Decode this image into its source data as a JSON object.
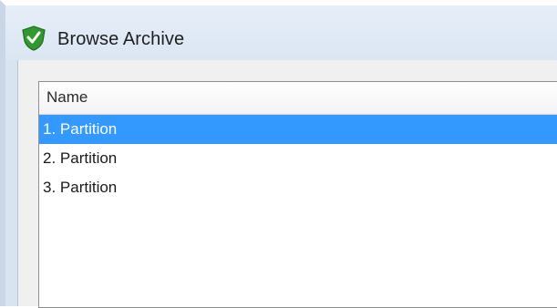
{
  "window": {
    "title": "Browse Archive",
    "icon": "shield-check-icon"
  },
  "list": {
    "columns": [
      "Name"
    ],
    "rows": [
      {
        "name": "1. Partition",
        "selected": true
      },
      {
        "name": "2. Partition",
        "selected": false
      },
      {
        "name": "3. Partition",
        "selected": false
      }
    ]
  },
  "colors": {
    "selection": "#3399ff",
    "icon_green": "#2f9b2f"
  }
}
